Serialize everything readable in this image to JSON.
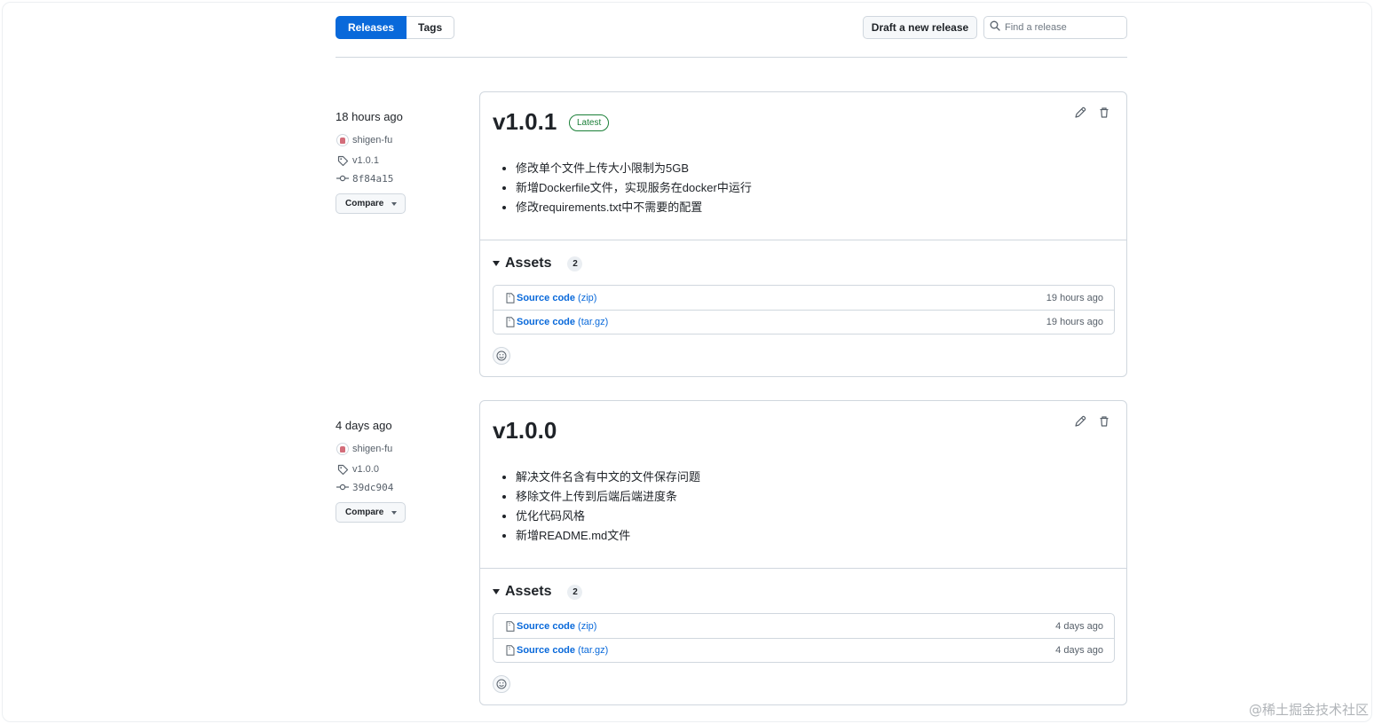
{
  "nav": {
    "tabs": [
      {
        "label": "Releases",
        "active": true
      },
      {
        "label": "Tags",
        "active": false
      }
    ],
    "draft_label": "Draft a new release",
    "search_placeholder": "Find a release"
  },
  "colors": {
    "accent": "#0969da",
    "latest_badge": "#1a7f37",
    "border": "#d0d7de"
  },
  "releases": [
    {
      "when": "18 hours ago",
      "author": "shigen-fu",
      "tag": "v1.0.1",
      "commit": "8f84a15",
      "compare_label": "Compare",
      "title": "v1.0.1",
      "badge": "Latest",
      "notes": [
        "修改单个文件上传大小限制为5GB",
        "新增Dockerfile文件，实现服务在docker中运行",
        "修改requirements.txt中不需要的配置"
      ],
      "assets_label": "Assets",
      "assets_count": "2",
      "assets": [
        {
          "name": "Source code",
          "ext": "(zip)",
          "time": "19 hours ago"
        },
        {
          "name": "Source code",
          "ext": "(tar.gz)",
          "time": "19 hours ago"
        }
      ]
    },
    {
      "when": "4 days ago",
      "author": "shigen-fu",
      "tag": "v1.0.0",
      "commit": "39dc904",
      "compare_label": "Compare",
      "title": "v1.0.0",
      "badge": "",
      "notes": [
        "解决文件名含有中文的文件保存问题",
        "移除文件上传到后端后端进度条",
        "优化代码风格",
        "新增README.md文件"
      ],
      "assets_label": "Assets",
      "assets_count": "2",
      "assets": [
        {
          "name": "Source code",
          "ext": "(zip)",
          "time": "4 days ago"
        },
        {
          "name": "Source code",
          "ext": "(tar.gz)",
          "time": "4 days ago"
        }
      ]
    }
  ],
  "watermark": "@稀土掘金技术社区"
}
